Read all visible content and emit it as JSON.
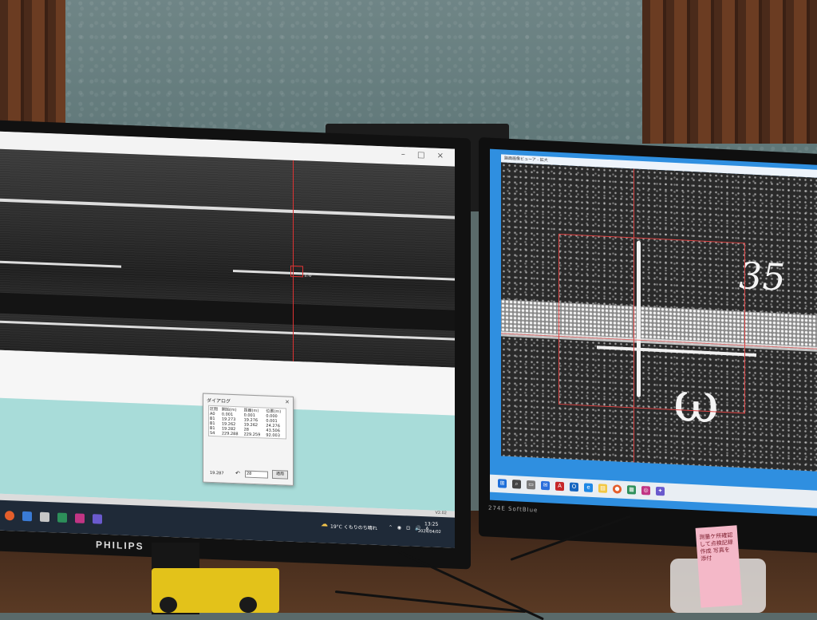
{
  "left_monitor": {
    "brand": "PHILIPS",
    "window_controls": "– □ ×",
    "cursor_value": "1.0",
    "dialog": {
      "title": "ダイアログ",
      "close_label": "×",
      "columns": [
        "区間",
        "開始(m)",
        "距離(m)",
        "位置(m)"
      ],
      "rows": [
        [
          "A0",
          "0.001",
          "0.001",
          "0.000"
        ],
        [
          "B1",
          "19.273",
          "19.276",
          "0.001"
        ],
        [
          "B1",
          "19.262",
          "19.262",
          "24.276"
        ],
        [
          "B1",
          "19.282",
          "28",
          "43.506"
        ],
        [
          "S4",
          "229.288",
          "229.259",
          "92.003"
        ]
      ],
      "bottom_value": "19.287",
      "reset_icon": "↶",
      "input_value": "28",
      "ok_label": "適用"
    },
    "status_version": "V2.02",
    "taskbar": {
      "icons": [
        "chrome-icon",
        "app-icon",
        "explorer-icon",
        "spreadsheet-icon",
        "instagram-icon",
        "tool-icon"
      ],
      "weather_icon": "☁",
      "weather_text": "19°C くもりのち晴れ",
      "tray_icons": "⌃ ◉ ⊡ 🔊 A",
      "time": "13:25",
      "date": "2024/04/02"
    }
  },
  "right_monitor": {
    "brand": "274E SoftBlue",
    "window_title": "路面画像ビューア - 拡大",
    "chalk_number": "35",
    "chalk_symbol": "ω",
    "taskbar_icons": [
      "windows-icon",
      "search-icon",
      "task-view-icon",
      "mail-icon",
      "acrobat-icon",
      "outlook-icon",
      "edge-icon",
      "folder-icon",
      "chrome-icon",
      "spreadsheet-icon",
      "instagram-icon",
      "tool-icon"
    ],
    "taskbar_letters": [
      "⊞",
      "⌕",
      "▭",
      "✉",
      "A",
      "O",
      "e",
      "▤",
      "●",
      "▦",
      "◎",
      "✦"
    ]
  },
  "desk": {
    "sticky_note_text": "測量ケ所確認して点検記録作成 写真を添付"
  },
  "colors": {
    "cursor_red": "#d33",
    "screen_blue": "#2f8fe0",
    "cyan_panel": "#a8dcd9",
    "taskbar_dark": "#1f2a38"
  }
}
